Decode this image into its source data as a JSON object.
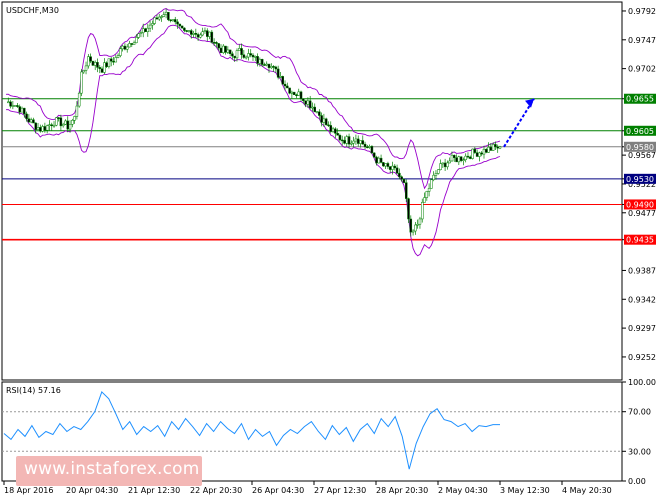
{
  "chart_data": [
    {
      "type": "candlestick",
      "title": "USDCHF,M30",
      "ylim": [
        0.9216,
        0.9806
      ],
      "y_ticks": [
        "0.9792",
        "0.9747",
        "0.9702",
        "0.9655",
        "0.9605",
        "0.9580",
        "0.9567",
        "0.9530",
        "0.9522",
        "0.9490",
        "0.9477",
        "0.9435",
        "0.9387",
        "0.9342",
        "0.9297",
        "0.9252"
      ],
      "x_tick_labels": [
        "18 Apr 2016",
        "20 Apr 04:30",
        "21 Apr 12:30",
        "22 Apr 20:30",
        "26 Apr 04:30",
        "27 Apr 12:30",
        "28 Apr 20:30",
        "2 May 04:30",
        "3 May 12:30",
        "4 May 20:30"
      ],
      "indicator": "Bollinger Bands",
      "price_path": [
        0.965,
        0.9648,
        0.964,
        0.9625,
        0.9615,
        0.9608,
        0.9612,
        0.962,
        0.9618,
        0.9612,
        0.9625,
        0.969,
        0.972,
        0.9708,
        0.9702,
        0.9712,
        0.9718,
        0.9735,
        0.9742,
        0.9752,
        0.9758,
        0.977,
        0.978,
        0.979,
        0.978,
        0.9765,
        0.9758,
        0.9762,
        0.9755,
        0.9758,
        0.975,
        0.9735,
        0.9728,
        0.9722,
        0.9728,
        0.9725,
        0.9718,
        0.9712,
        0.9715,
        0.97,
        0.969,
        0.9672,
        0.9665,
        0.966,
        0.965,
        0.964,
        0.9625,
        0.961,
        0.9598,
        0.9592,
        0.959,
        0.9595,
        0.9585,
        0.9575,
        0.956,
        0.955,
        0.9545,
        0.954,
        0.952,
        0.944,
        0.946,
        0.95,
        0.9525,
        0.9545,
        0.9555,
        0.956,
        0.9562,
        0.9565,
        0.957,
        0.9572,
        0.9575,
        0.9578,
        0.958
      ],
      "forecast_target": 0.9655,
      "levels": [
        {
          "value": 0.9655,
          "label": "0.9655",
          "color": "#008000",
          "role": "resistance"
        },
        {
          "value": 0.9605,
          "label": "0.9605",
          "color": "#008000",
          "role": "resistance"
        },
        {
          "value": 0.958,
          "label": "0.9580",
          "color": "#808080",
          "role": "current price"
        },
        {
          "value": 0.953,
          "label": "0.9530",
          "color": "#000080",
          "role": "pivot"
        },
        {
          "value": 0.949,
          "label": "0.9490",
          "color": "#ff0000",
          "role": "support"
        },
        {
          "value": 0.9435,
          "label": "0.9435",
          "color": "#ff0000",
          "role": "support"
        }
      ],
      "colors": {
        "candle": "#008000",
        "bands": "#9900cc",
        "arrow": "#0000ff"
      }
    },
    {
      "type": "line",
      "title": "RSI(14) 57.16",
      "ylim": [
        0,
        100
      ],
      "y_ticks": [
        "100.00",
        "70.00",
        "30.00",
        "0.00"
      ],
      "x_tick_labels": [
        "18 Apr 2016",
        "20 Apr 04:30",
        "21 Apr 12:30",
        "22 Apr 20:30",
        "26 Apr 04:30",
        "27 Apr 12:30",
        "28 Apr 20:30",
        "2 May 04:30",
        "3 May 12:30",
        "4 May 20:30"
      ],
      "levels": [
        70,
        30
      ],
      "series": [
        {
          "values": [
            48,
            42,
            52,
            45,
            56,
            44,
            50,
            47,
            58,
            50,
            55,
            52,
            60,
            70,
            90,
            83,
            68,
            52,
            60,
            47,
            55,
            50,
            56,
            45,
            60,
            52,
            63,
            55,
            46,
            58,
            50,
            60,
            53,
            48,
            58,
            42,
            52,
            45,
            50,
            36,
            46,
            52,
            48,
            55,
            60,
            50,
            42,
            56,
            47,
            54,
            40,
            52,
            58,
            48,
            63,
            55,
            65,
            45,
            12,
            38,
            55,
            68,
            73,
            62,
            60,
            55,
            58,
            50,
            56,
            55,
            57,
            57
          ],
          "color": "#1e90ff"
        }
      ]
    }
  ],
  "watermark": "www.instaforex.com"
}
